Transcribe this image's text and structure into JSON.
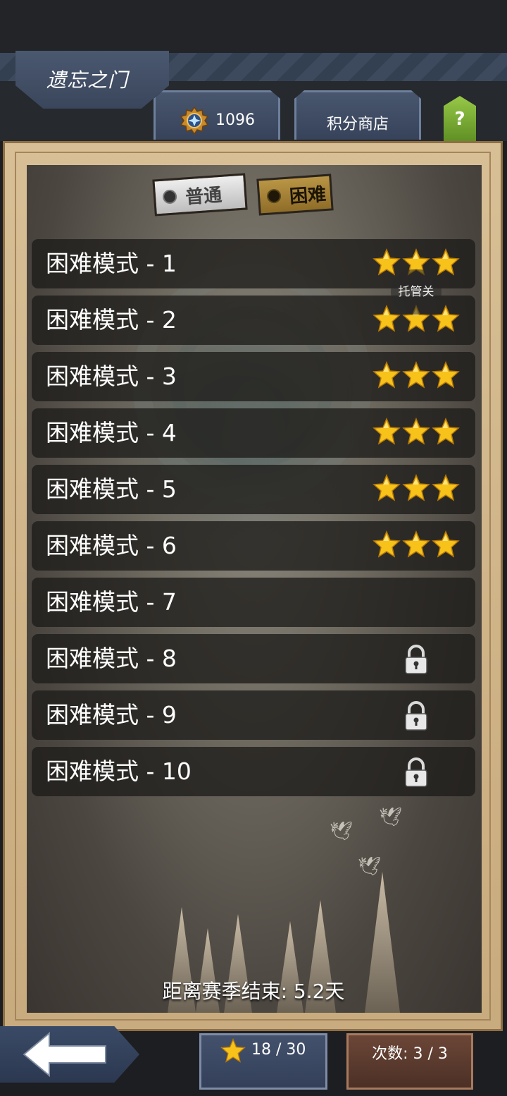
{
  "header": {
    "title": "遗忘之门",
    "points": "1096",
    "shop_label": "积分商店",
    "help_label": "?"
  },
  "mode_tabs": [
    {
      "label": "普通",
      "selected": false
    },
    {
      "label": "困难",
      "selected": true
    }
  ],
  "levels": [
    {
      "name": "困难模式 - 1",
      "stars": 3,
      "locked": false
    },
    {
      "name": "困难模式 - 2",
      "stars": 3,
      "locked": false
    },
    {
      "name": "困难模式 - 3",
      "stars": 3,
      "locked": false
    },
    {
      "name": "困难模式 - 4",
      "stars": 3,
      "locked": false
    },
    {
      "name": "困难模式 - 5",
      "stars": 3,
      "locked": false
    },
    {
      "name": "困难模式 - 6",
      "stars": 3,
      "locked": false
    },
    {
      "name": "困难模式 - 7",
      "stars": 0,
      "locked": false
    },
    {
      "name": "困难模式 - 8",
      "stars": 0,
      "locked": true
    },
    {
      "name": "困难模式 - 9",
      "stars": 0,
      "locked": true
    },
    {
      "name": "困难模式 - 10",
      "stars": 0,
      "locked": true
    }
  ],
  "auto_battle_label": "托管关",
  "season": {
    "text": "距离赛季结束: 5.2天"
  },
  "footer": {
    "stars_progress": "18 / 30",
    "attempts": "次数: 3 / 3"
  },
  "icons": {
    "medal": "medal-icon",
    "star": "star-icon",
    "lock": "lock-icon",
    "back": "back-arrow-icon",
    "help": "help-icon"
  },
  "colors": {
    "star": "#f7c21a",
    "frame": "#d8bf95",
    "hard_tab": "#b99545",
    "normal_tab": "#e0e0e0",
    "help_button": "#7fb83a"
  }
}
